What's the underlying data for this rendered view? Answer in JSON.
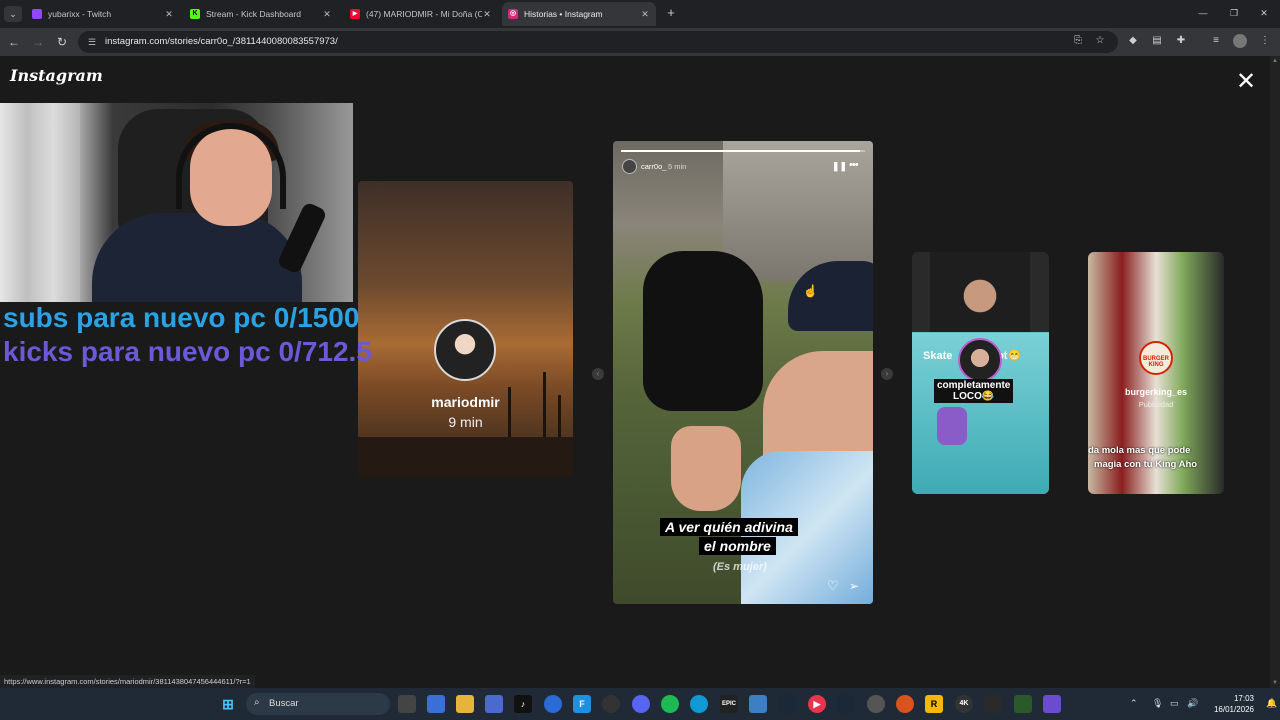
{
  "browser": {
    "tabs": [
      {
        "title": "yubarixx - Twitch",
        "favicon_color": "#9146ff",
        "favicon_glyph": ""
      },
      {
        "title": "Stream - Kick Dashboard",
        "favicon_color": "#53fc18",
        "favicon_glyph": "K"
      },
      {
        "title": "(47) MARIODMIR - Mi Doña (O",
        "favicon_color": "#ff0033",
        "favicon_glyph": "▶"
      },
      {
        "title": "Historias • Instagram",
        "favicon_color": "#d62976",
        "favicon_glyph": "◎"
      }
    ],
    "active_tab": 3,
    "url": "instagram.com/stories/carr0o_/3811440080083557973/",
    "status_url": "https://www.instagram.com/stories/mariodmir/3811438047456444611/?r=1"
  },
  "page": {
    "logo": "Instagram",
    "close_icon": "close-icon"
  },
  "overlay": {
    "goal_subs": "subs para nuevo pc 0/1500",
    "goal_kicks": "kicks para nuevo pc 0/712.5"
  },
  "stories": {
    "left": {
      "username": "mariodmir",
      "time": "9 min"
    },
    "main": {
      "username": "carr0o_",
      "time": "5 min",
      "progress": 0.98,
      "caption_line1": "A ver quién adivina",
      "caption_line2": "el nombre",
      "caption_line3": "(Es mujer)"
    },
    "right1": {
      "game_text": "Skate",
      "game_text2": "hot😁",
      "label": "completamente",
      "label2": "LOCO😂"
    },
    "right2": {
      "username": "burgerking_es",
      "badge": "Publicidad",
      "logo_line1": "BURGER",
      "logo_line2": "KING",
      "subtitle1": "da mola mas que pode",
      "subtitle2": "magia con tu King Aho"
    }
  },
  "taskbar": {
    "search_placeholder": "Buscar",
    "time": "17:03",
    "date": "16/01/2026"
  }
}
